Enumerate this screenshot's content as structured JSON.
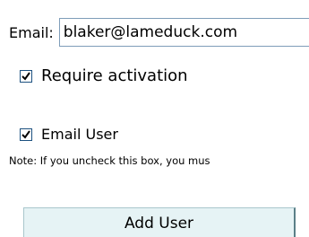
{
  "email": {
    "label": "Email:",
    "value": "blaker@lameduck.com"
  },
  "options": {
    "require_activation": {
      "label": "Require activation",
      "checked": true
    },
    "email_user": {
      "label": "Email User",
      "checked": true
    }
  },
  "note": "Note: If you uncheck this box, you mus",
  "add_button_label": "Add User",
  "colors": {
    "input_border": "#7f9db9",
    "checkbox_border": "#1c5180",
    "checkmark": "#000000",
    "button_background": "#e6f3f5",
    "button_border": "#a9c7cc"
  }
}
